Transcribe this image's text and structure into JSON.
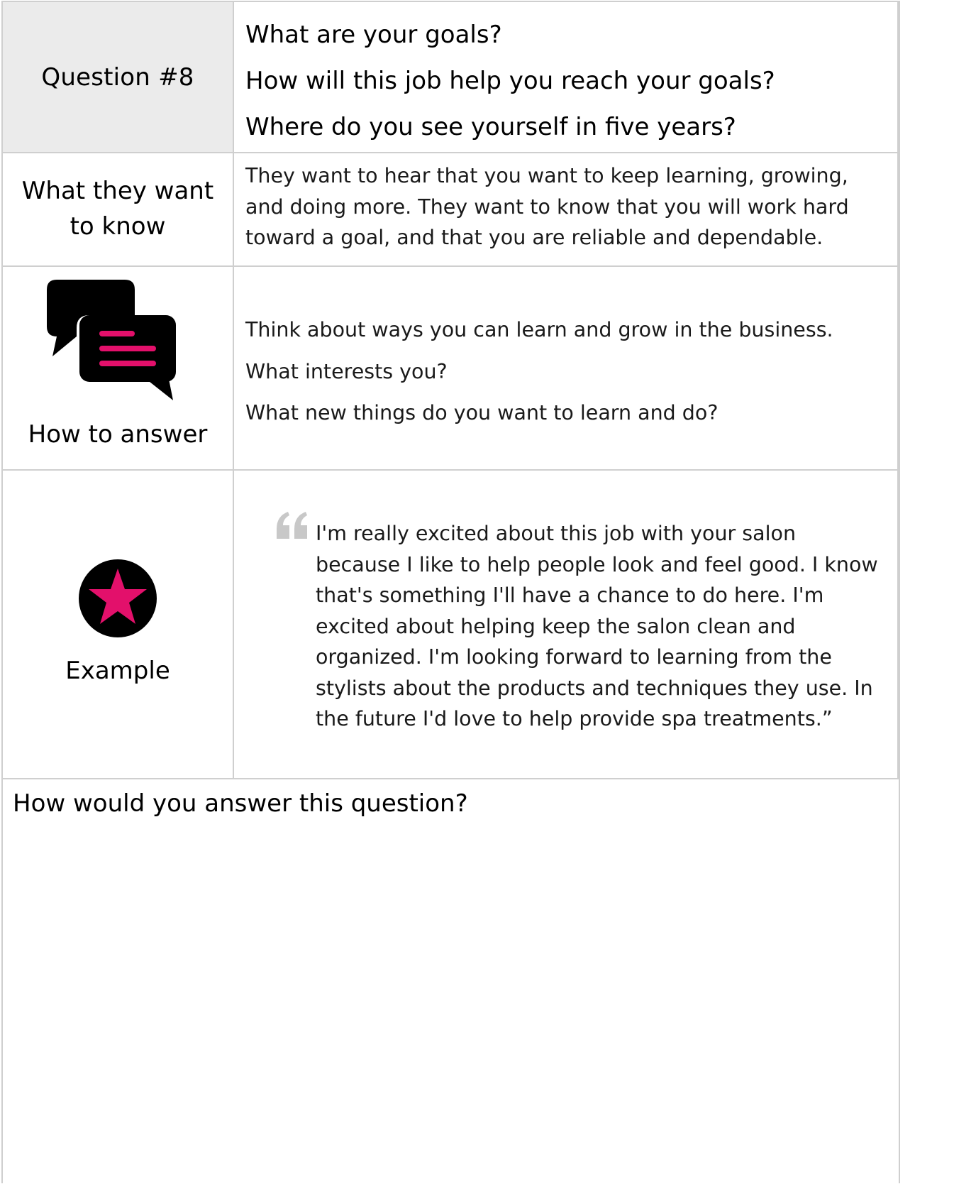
{
  "question": {
    "label": "Question #8",
    "lines": [
      "What are your goals?",
      "How will this job help you reach your goals?",
      "Where do you see yourself in five years?"
    ]
  },
  "what_they_want": {
    "label": "What they want to know",
    "text": "They want to hear that you want to keep learning, growing, and doing more. They want to know that you will work hard toward a goal, and that you are reliable and dependable."
  },
  "how_to_answer": {
    "label": "How to answer",
    "icon": "chat-bubbles-icon",
    "lines": [
      "Think about ways you can learn and grow in the business.",
      "What interests you?",
      "What new things do you want to learn and do?"
    ]
  },
  "example": {
    "label": "Example",
    "icon": "star-icon",
    "quote_icon": "quote-icon",
    "text": "I'm really excited about this job with your salon because I like to help people look and feel good. I know that's something I'll have a chance to do here. I'm excited about helping keep the salon clean and organized. I'm looking forward to learning from the stylists about the products and techniques they use. In the future I'd love to help provide spa treatments.”"
  },
  "answer_prompt": "How would you answer this question?",
  "colors": {
    "accent": "#e3106b",
    "icon_dark": "#000000",
    "header_bg": "#ebebeb",
    "border": "#cfcfcf",
    "quote_mark": "#c8c8c8"
  }
}
